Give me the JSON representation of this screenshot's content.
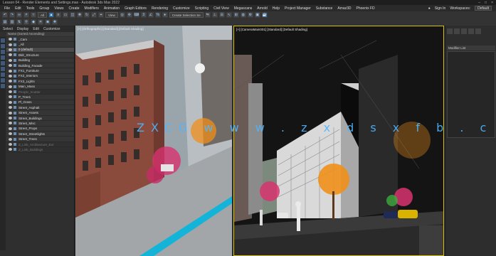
{
  "window": {
    "title": "Lesson 04 - Render Elements and Settings.max - Autodesk 3ds Max 2022"
  },
  "menu": {
    "items": [
      "File",
      "Edit",
      "Tools",
      "Group",
      "Views",
      "Create",
      "Modifiers",
      "Animation",
      "Graph Editors",
      "Rendering",
      "Customize",
      "Scripting",
      "Civil View",
      "Megascans",
      "Arnold",
      "Help",
      "Project Manager",
      "Substance",
      "Amaz3D",
      "Phoenix FD"
    ],
    "user": "Sign In",
    "workspace_label": "Workspaces:",
    "workspace_value": "Default"
  },
  "toolbar": {
    "selection_filter": "All",
    "view_dropdown": "View",
    "create_selection_set": "Create Selection Se"
  },
  "scene_explorer": {
    "tabs": [
      "Select",
      "Display",
      "Edit",
      "Customize"
    ],
    "header": "Name (Sorted Ascending)",
    "rows": [
      {
        "label": "_Cam",
        "state": "normal"
      },
      {
        "label": "_All",
        "state": "normal"
      },
      {
        "label": "0 (default)",
        "state": "normal"
      },
      {
        "label": "Bldr_Structure",
        "state": "normal"
      },
      {
        "label": "Building",
        "state": "normal"
      },
      {
        "label": "Building_Facade",
        "state": "normal"
      },
      {
        "label": "FX1_Furniture",
        "state": "normal"
      },
      {
        "label": "FX2_Interiors",
        "state": "normal"
      },
      {
        "label": "FX3_Lights",
        "state": "normal"
      },
      {
        "label": "Main_Mass",
        "state": "normal"
      },
      {
        "label": "People_Scatter",
        "state": "dim"
      },
      {
        "label": "P_Tree1",
        "state": "normal"
      },
      {
        "label": "Pl_Grass",
        "state": "normal"
      },
      {
        "label": "Street_Asphalt",
        "state": "normal"
      },
      {
        "label": "Street_Assets",
        "state": "normal"
      },
      {
        "label": "Street_Buildings",
        "state": "normal"
      },
      {
        "label": "Street_Misc",
        "state": "normal"
      },
      {
        "label": "Street_Props",
        "state": "normal"
      },
      {
        "label": "Street_Streetlights",
        "state": "normal"
      },
      {
        "label": "Street_Trees",
        "state": "normal"
      },
      {
        "label": "Z_Link_Architecture_Ext",
        "state": "dim"
      },
      {
        "label": "Z_Link_Buildings",
        "state": "dim"
      }
    ]
  },
  "viewports": {
    "left_label": "[+] [Orthographic] [Standard] [Default Shading]",
    "right_label": "[+] [CameraMain001] [Standard] [Default Shading]"
  },
  "command_panel": {
    "modifier_list_label": "Modifier List"
  },
  "watermark": "ZXCG  w w w . z x d s x f b . c n",
  "colors": {
    "viewport_border_active": "#d6c000",
    "accent": "#2f6fa8",
    "panel_bg": "#2d2d2d",
    "tree_magenta": "#d8326f",
    "tree_orange": "#f08f1a"
  }
}
